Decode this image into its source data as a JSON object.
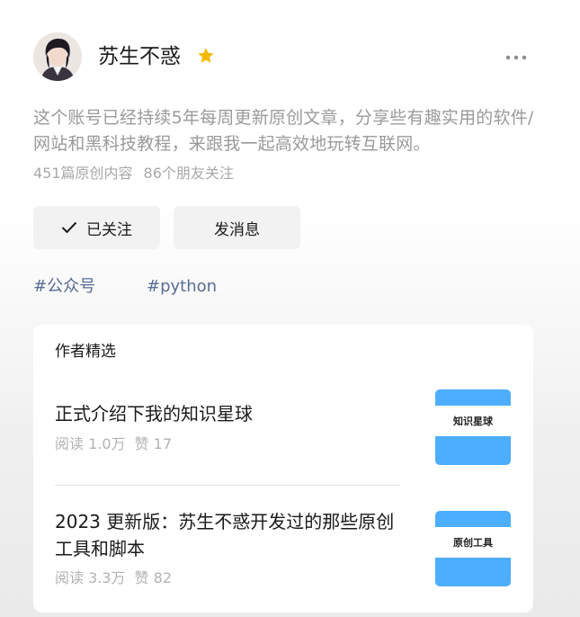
{
  "profile": {
    "name": "苏生不惑",
    "bio": "这个账号已经持续5年每周更新原创文章，分享些有趣实用的软件/网站和黑科技教程，来跟我一起高效地玩转互联网。",
    "stats": {
      "articles": "451篇原创内容",
      "friends_following": "86个朋友关注"
    }
  },
  "actions": {
    "follow_label": "已关注",
    "message_label": "发消息"
  },
  "tags": [
    "#公众号",
    "#python"
  ],
  "featured": {
    "title": "作者精选",
    "articles": [
      {
        "title": "正式介绍下我的知识星球",
        "reads": "阅读 1.0万",
        "likes": "赞 17",
        "thumb_text": "知识星球"
      },
      {
        "title": "2023 更新版：苏生不惑开发过的那些原创工具和脚本",
        "reads": "阅读 3.3万",
        "likes": "赞 82",
        "thumb_text": "原创工具"
      }
    ]
  },
  "colors": {
    "star": "#f5b800",
    "tag": "#576b95",
    "thumb": "#4daeff",
    "muted_text": "#9a9a9a"
  },
  "icons": {
    "star": "star-icon",
    "more": "more-dots-icon",
    "check": "check-icon"
  }
}
